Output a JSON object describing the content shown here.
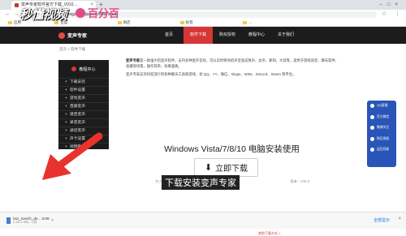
{
  "browser": {
    "tab_title": "变声专家软件官方下载_V010…",
    "url": "www.bianshengzhuanjia.com/download/",
    "bookmarks": [
      "应用",
      "百度",
      "商店",
      "标签",
      "…"
    ]
  },
  "watermark": {
    "logo": "秒懂视频",
    "brand": "百分百"
  },
  "site": {
    "logo": "变声专家",
    "nav": [
      "首页",
      "软件下载",
      "购买授权",
      "教程中心",
      "关于我们"
    ],
    "active_nav": "软件下载"
  },
  "breadcrumb": "首页 > 软件下载",
  "sidebar": {
    "title": "教程中心",
    "items": [
      "下载安装",
      "软件设置",
      "游戏变声",
      "直播变声",
      "语音变声",
      "录音变声",
      "通话变声",
      "声卡设置",
      "视频教程"
    ]
  },
  "content": {
    "para1_bold": "变声专家",
    "para1": "是一款强大的变声软件，支持多种变声音效，可以实时将你的声音变成男声、女声、萝莉、大叔等，适用于游戏语音、聊天软件、直播等场景，操作简单，效果逼真。",
    "para2": "变声专家支持目前流行的各种聊天工具和游戏，如 QQ、YY、微信、Skype、MSN、Discord、Steam 等平台。",
    "download_title": "Windows Vista/7/8/10 电脑安装使用",
    "download_button": "立即下载",
    "meta": [
      "大小：46.8MB",
      "版本：V10.3"
    ],
    "alt_link": "其他下载方式 >"
  },
  "float_panel": [
    "QQ客服",
    "官方微信",
    "微博关注",
    "购买授权",
    "返回顶部"
  ],
  "subtitle": "下载安装变声专家",
  "download_bar": {
    "file_name": "bsz_soecfz_de….EXE",
    "file_size": "0.3/2.1 MB，3 秒",
    "show_all": "全部显示"
  },
  "colors": {
    "accent": "#d63636",
    "header": "#1c1c1c",
    "float_panel": "#2a55b8",
    "watermark": "#e24a8a"
  }
}
